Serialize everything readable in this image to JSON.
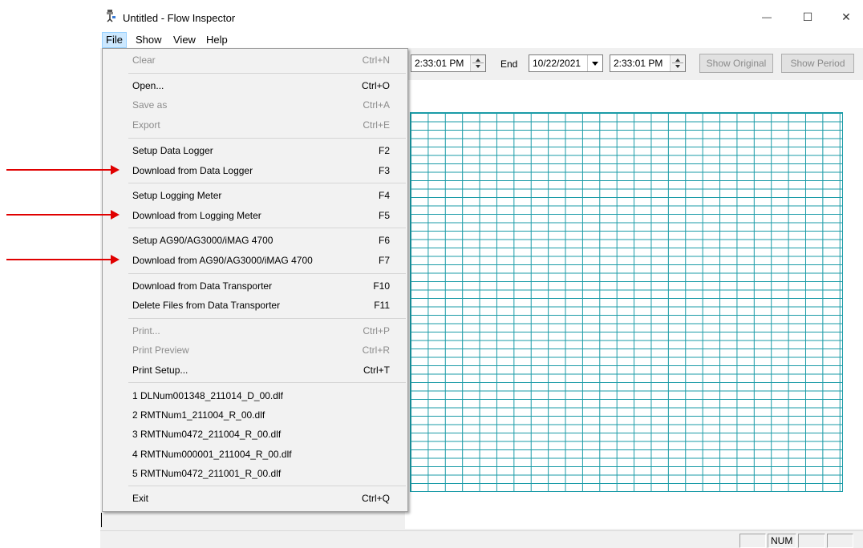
{
  "window": {
    "title": "Untitled - Flow Inspector",
    "minimize_glyph": "—",
    "maximize_glyph": "☐",
    "close_glyph": "✕"
  },
  "menubar": [
    "File",
    "Show",
    "View",
    "Help"
  ],
  "toolbar": {
    "start_time": "2:33:01 PM",
    "end_label": "End",
    "end_date": "10/22/2021",
    "end_time": "2:33:01 PM",
    "show_original": "Show Original",
    "show_period": "Show Period"
  },
  "file_menu": [
    {
      "label": "Clear",
      "shortcut": "Ctrl+N",
      "enabled": false
    },
    {
      "label": "Open...",
      "shortcut": "Ctrl+O",
      "enabled": true
    },
    {
      "label": "Save as",
      "shortcut": "Ctrl+A",
      "enabled": false
    },
    {
      "label": "Export",
      "shortcut": "Ctrl+E",
      "enabled": false
    },
    {
      "label": "Setup Data Logger",
      "shortcut": "F2",
      "enabled": true
    },
    {
      "label": "Download from Data Logger",
      "shortcut": "F3",
      "enabled": true
    },
    {
      "label": "Setup Logging Meter",
      "shortcut": "F4",
      "enabled": true
    },
    {
      "label": "Download from Logging Meter",
      "shortcut": "F5",
      "enabled": true
    },
    {
      "label": "Setup AG90/AG3000/iMAG 4700",
      "shortcut": "F6",
      "enabled": true
    },
    {
      "label": "Download from AG90/AG3000/iMAG 4700",
      "shortcut": "F7",
      "enabled": true
    },
    {
      "label": "Download from Data Transporter",
      "shortcut": "F10",
      "enabled": true
    },
    {
      "label": "Delete Files from Data Transporter",
      "shortcut": "F11",
      "enabled": true
    },
    {
      "label": "Print...",
      "shortcut": "Ctrl+P",
      "enabled": false
    },
    {
      "label": "Print Preview",
      "shortcut": "Ctrl+R",
      "enabled": false
    },
    {
      "label": "Print Setup...",
      "shortcut": "Ctrl+T",
      "enabled": true
    },
    {
      "label": "1 DLNum001348_211014_D_00.dlf",
      "shortcut": "",
      "enabled": true
    },
    {
      "label": "2 RMTNum1_211004_R_00.dlf",
      "shortcut": "",
      "enabled": true
    },
    {
      "label": "3 RMTNum0472_211004_R_00.dlf",
      "shortcut": "",
      "enabled": true
    },
    {
      "label": "4 RMTNum000001_211004_R_00.dlf",
      "shortcut": "",
      "enabled": true
    },
    {
      "label": "5 RMTNum0472_211001_R_00.dlf",
      "shortcut": "",
      "enabled": true
    },
    {
      "label": "Exit",
      "shortcut": "Ctrl+Q",
      "enabled": true
    }
  ],
  "statusbar": {
    "num": "NUM"
  },
  "colors": {
    "grid": "#1a9ba7",
    "annotation_arrow": "#e00000",
    "menu_highlight": "#cce8ff"
  }
}
